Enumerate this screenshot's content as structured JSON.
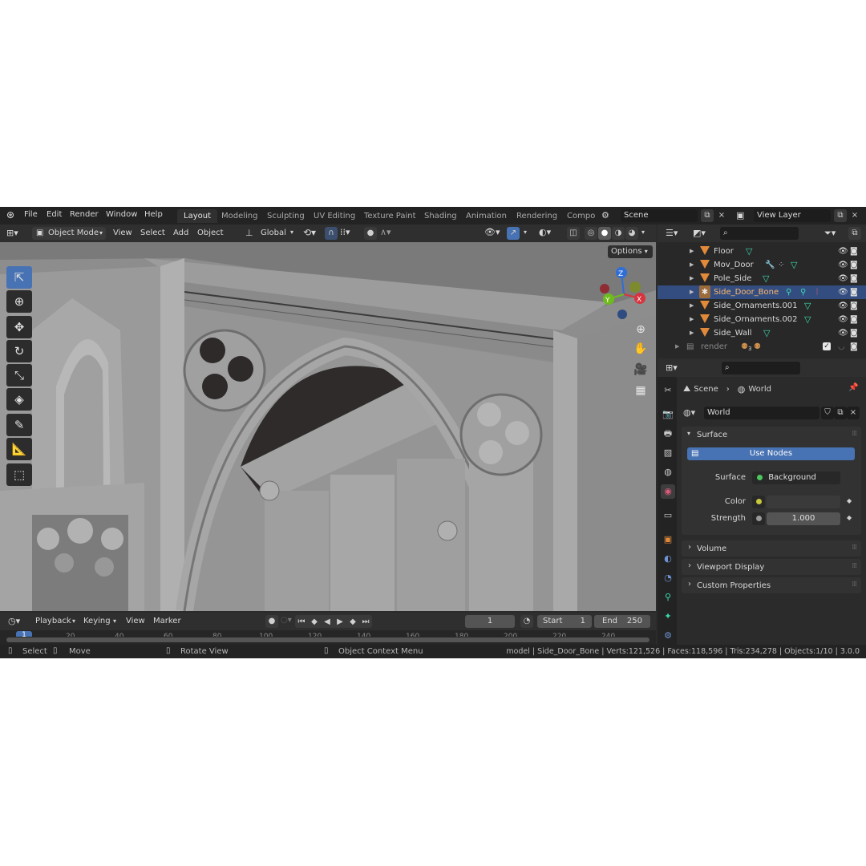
{
  "menu": {
    "items": [
      "File",
      "Edit",
      "Render",
      "Window",
      "Help"
    ],
    "workspaces": [
      "Layout",
      "Modeling",
      "Sculpting",
      "UV Editing",
      "Texture Paint",
      "Shading",
      "Animation",
      "Rendering",
      "Compo"
    ],
    "active_workspace": "Layout",
    "scene": "Scene",
    "view_layer": "View Layer"
  },
  "viewport_header": {
    "mode": "Object Mode",
    "menus": [
      "View",
      "Select",
      "Add",
      "Object"
    ],
    "orientation": "Global",
    "options_label": "Options"
  },
  "gizmo": {
    "z": "Z",
    "y": "Y",
    "x": "X"
  },
  "outliner": {
    "items": [
      {
        "name": "Floor"
      },
      {
        "name": "Mov_Door"
      },
      {
        "name": "Pole_Side"
      },
      {
        "name": "Side_Door_Bone"
      },
      {
        "name": "Side_Ornaments.001"
      },
      {
        "name": "Side_Ornaments.002"
      },
      {
        "name": "Side_Wall"
      }
    ],
    "selected_index": 3,
    "collection": {
      "name": "render",
      "badge": "3"
    }
  },
  "properties": {
    "breadcrumb": {
      "scene": "Scene",
      "world": "World"
    },
    "world_name": "World",
    "surface_panel": {
      "title": "Surface",
      "use_nodes": "Use Nodes",
      "surface_label": "Surface",
      "surface_value": "Background",
      "color_label": "Color",
      "strength_label": "Strength",
      "strength_value": "1.000"
    },
    "collapsed_panels": [
      "Volume",
      "Viewport Display",
      "Custom Properties"
    ],
    "colors": {
      "surface_dot": "#4cc75d",
      "color_dot": "#c8c83c",
      "strength_dot": "#9a9a9a",
      "accent": "#4772b3"
    }
  },
  "timeline": {
    "menus": [
      "Playback",
      "Keying",
      "View",
      "Marker"
    ],
    "current_frame": "1",
    "start_label": "Start",
    "start_value": "1",
    "end_label": "End",
    "end_value": "250",
    "ruler_ticks": [
      "1",
      "20",
      "40",
      "60",
      "80",
      "100",
      "120",
      "140",
      "160",
      "180",
      "200",
      "220",
      "240"
    ]
  },
  "statusbar": {
    "select": "Select",
    "move": "Move",
    "rotate": "Rotate View",
    "context": "Object Context Menu",
    "info": "model | Side_Door_Bone | Verts:121,526 | Faces:118,596 | Tris:234,278 | Objects:1/10 | 3.0.0"
  }
}
